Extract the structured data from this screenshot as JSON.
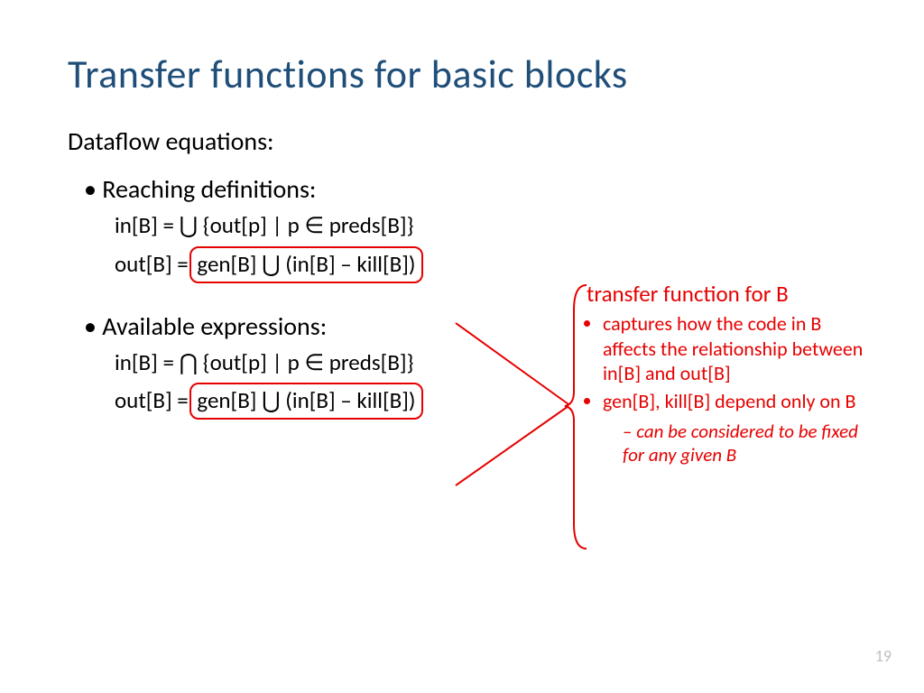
{
  "title": "Transfer functions for basic blocks",
  "subhead": "Dataflow equations:",
  "sections": [
    {
      "heading": "Reaching definitions:",
      "eq_in_prefix": "in[B] = ",
      "eq_in_op": "⋃",
      "eq_in_rest": " {out[p] | p ∈ preds[B]}",
      "eq_out_prefix": "out[B] = ",
      "eq_out_boxed": "gen[B] ⋃ (in[B] – kill[B])"
    },
    {
      "heading": "Available expressions:",
      "eq_in_prefix": "in[B] = ",
      "eq_in_op": "⋂",
      "eq_in_rest": " {out[p] | p ∈ preds[B]}",
      "eq_out_prefix": "out[B] = ",
      "eq_out_boxed": "gen[B] ⋃ (in[B] – kill[B])"
    }
  ],
  "callout": {
    "title": "transfer function for B",
    "items": [
      "captures how the code in B affects the relationship between in[B] and out[B]",
      "gen[B], kill[B] depend only on B"
    ],
    "subitems": [
      "can be considered to be fixed for any given B"
    ]
  },
  "page_number": "19"
}
